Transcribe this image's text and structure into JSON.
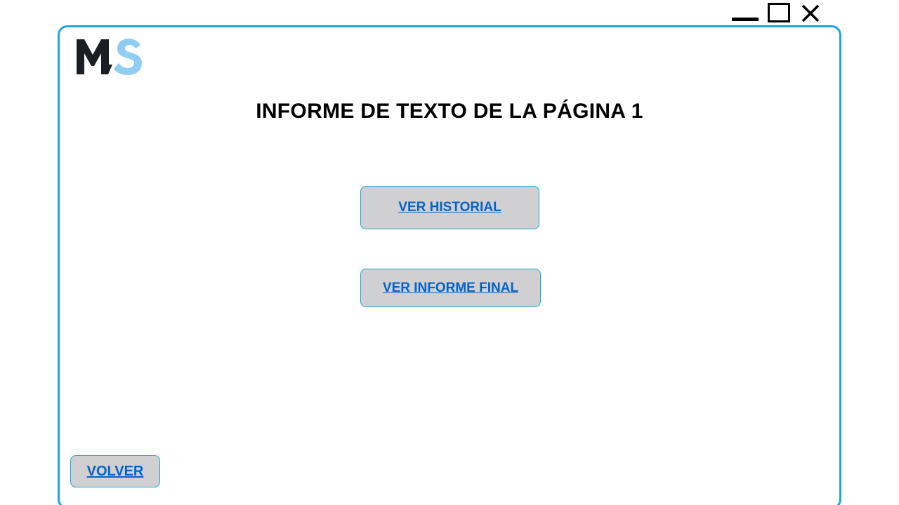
{
  "window": {
    "controls": [
      "minimize-icon",
      "maximize-icon",
      "close-icon"
    ]
  },
  "logo": {
    "text": "MS",
    "colors": {
      "m": "#1b1f24",
      "s": "#8fcdf4"
    }
  },
  "page_title": "INFORME DE TEXTO DE LA PÁGINA 1",
  "buttons": {
    "historial": "VER HISTORIAL",
    "informe_final": "VER INFORME FINAL",
    "volver": "VOLVER"
  },
  "colors": {
    "frame_border": "#1aa7dc",
    "button_bg": "#d0cfd1",
    "link_text": "#0563c1"
  }
}
